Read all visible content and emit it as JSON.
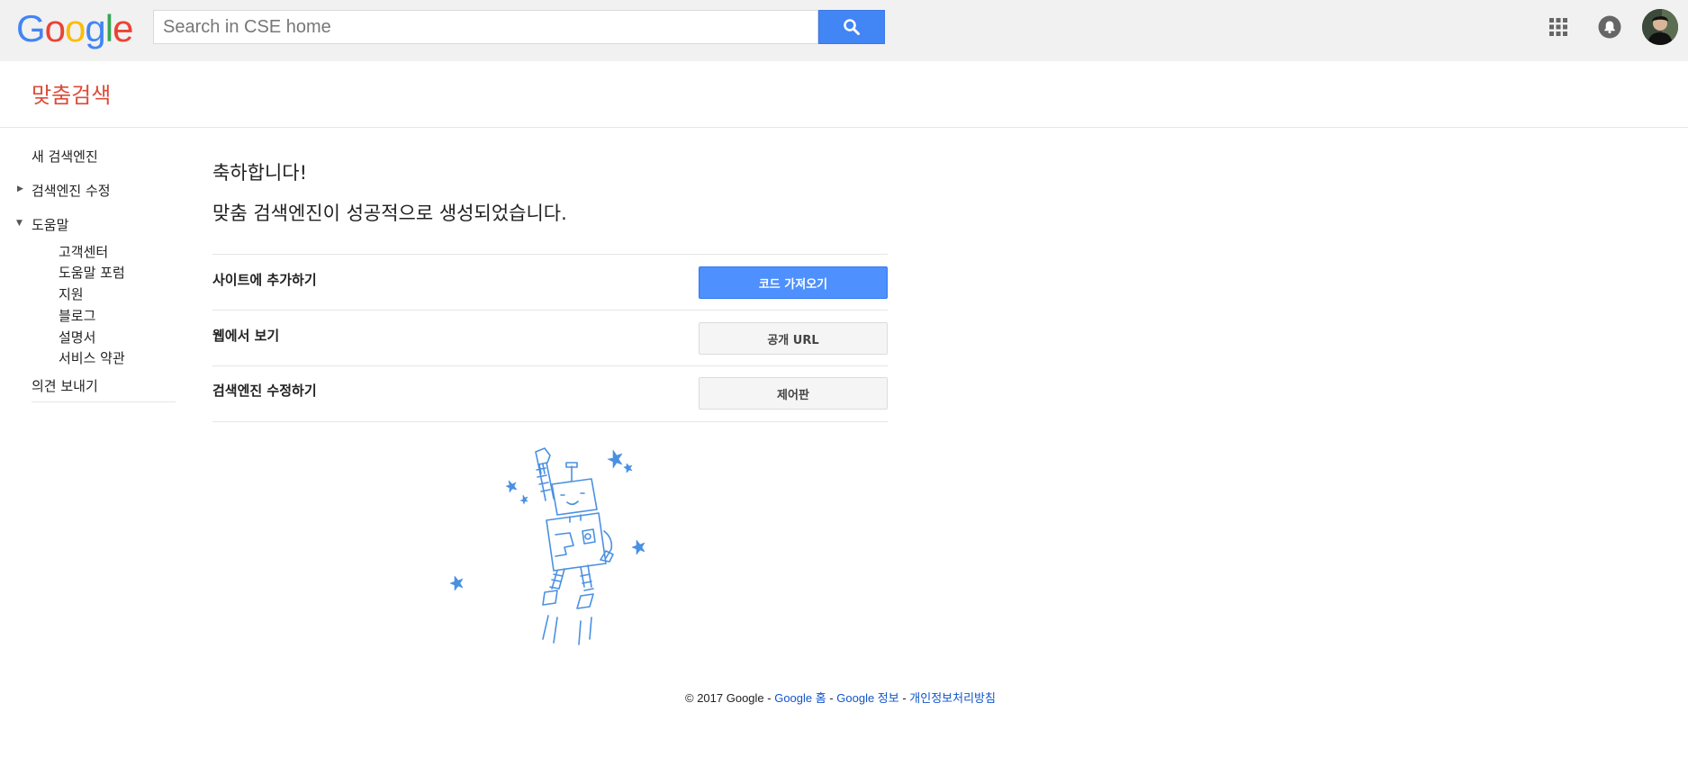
{
  "header": {
    "logo_letters": [
      {
        "ch": "G",
        "color": "#4285f4"
      },
      {
        "ch": "o",
        "color": "#ea4335"
      },
      {
        "ch": "o",
        "color": "#fbbc05"
      },
      {
        "ch": "g",
        "color": "#4285f4"
      },
      {
        "ch": "l",
        "color": "#34a853"
      },
      {
        "ch": "e",
        "color": "#ea4335"
      }
    ],
    "search_placeholder": "Search in CSE home",
    "search_icon": "search-icon",
    "apps_icon": "apps-grid-icon",
    "notifications_icon": "bell-icon"
  },
  "product": {
    "title": "맞춤검색",
    "accent": "#dd4b39"
  },
  "sidebar": {
    "new_engine": "새 검색엔진",
    "edit_engine": "검색엔진 수정",
    "help": "도움말",
    "help_items": [
      "고객센터",
      "도움말 포럼",
      "지원",
      "블로그",
      "설명서",
      "서비스 약관"
    ],
    "feedback": "의견 보내기"
  },
  "main": {
    "title": "축하합니다!",
    "subtitle": "맞춤 검색엔진이 성공적으로 생성되었습니다.",
    "rows": [
      {
        "label": "사이트에 추가하기",
        "button": "코드 가져오기"
      },
      {
        "label": "웹에서 보기",
        "button": "공개 URL"
      },
      {
        "label": "검색엔진 수정하기",
        "button": "제어판"
      }
    ],
    "illustration": "robot-illustration"
  },
  "footer": {
    "copyright": "© 2017 Google - ",
    "link_home": "Google 홈",
    "sep1": " - ",
    "link_about": "Google 정보",
    "sep2": " - ",
    "link_privacy": "개인정보처리방침"
  },
  "colors": {
    "primary_button": "#4d90fe",
    "link": "#1155cc",
    "illustration": "#4a90e2"
  }
}
